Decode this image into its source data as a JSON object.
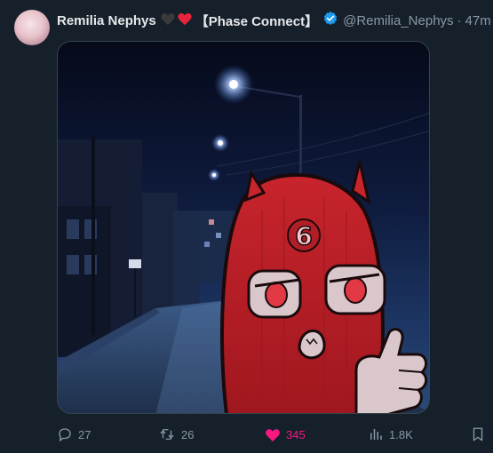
{
  "tweet": {
    "author_name": "Remilia Nephys",
    "emoji_hearts": [
      "black-heart",
      "red-heart"
    ],
    "affiliation": "【Phase Connect】",
    "handle": "@Remilia_Nephys",
    "separator": "·",
    "time": "47m",
    "verified": true
  },
  "media": {
    "description_icon": "night-street-image",
    "mask_number": "6"
  },
  "actions": {
    "replies": "27",
    "reposts": "26",
    "likes": "345",
    "views": "1.8K"
  },
  "colors": {
    "background": "#15202b",
    "like_pink": "#f91880",
    "verified_blue": "#1d9bf0",
    "muted": "#8b98a5"
  }
}
